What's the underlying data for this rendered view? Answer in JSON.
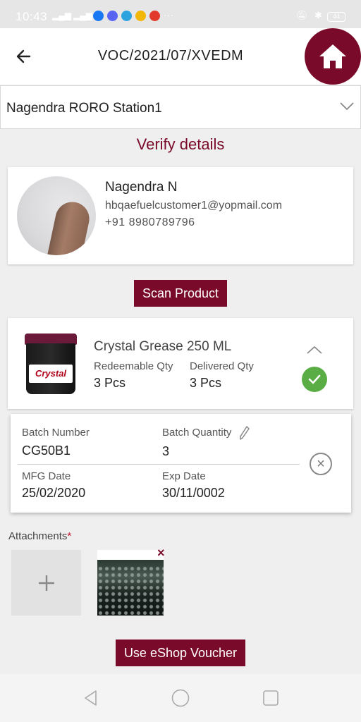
{
  "status_bar": {
    "time": "10:43",
    "network_a": "⁴ᴳ",
    "network_b": "",
    "battery": "44"
  },
  "header": {
    "title": "VOC/2021/07/XVEDM",
    "back_icon": "arrow-left-icon",
    "home_icon": "home-icon"
  },
  "station": {
    "selected": "Nagendra RORO Station1",
    "chevron_icon": "chevron-down-icon"
  },
  "section_title": "Verify details",
  "customer": {
    "name": "Nagendra N",
    "email": "hbqaefuelcustomer1@yopmail.com",
    "phone": "+91 8980789796"
  },
  "scan_button": "Scan Product",
  "product": {
    "name": "Crystal Grease 250 ML",
    "jar_text": "Crystal",
    "redeemable_label": "Redeemable Qty",
    "redeemable_value": "3 Pcs",
    "delivered_label": "Delivered Qty",
    "delivered_value": "3 Pcs"
  },
  "batch": {
    "batch_number_label": "Batch Number",
    "batch_number": "CG50B1",
    "batch_quantity_label": "Batch Quantity",
    "batch_quantity": "3",
    "mfg_label": "MFG Date",
    "mfg_date": "25/02/2020",
    "exp_label": "Exp Date",
    "exp_date": "30/11/0002"
  },
  "attachments": {
    "label": "Attachments",
    "required_mark": "*"
  },
  "voucher_button": "Use eShop Voucher",
  "colors": {
    "brand": "#7a0a2a",
    "success": "#5aad45"
  }
}
